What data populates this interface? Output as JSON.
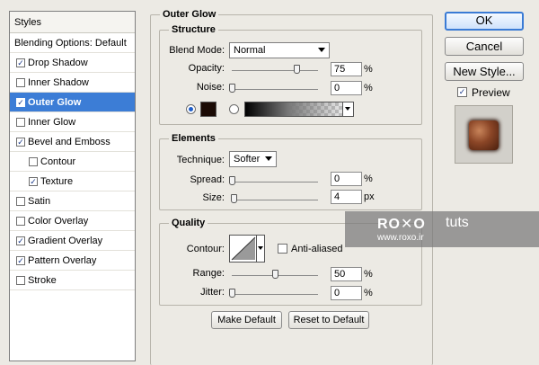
{
  "styles_list": {
    "header": "Styles",
    "blending": "Blending Options: Default",
    "items": [
      {
        "label": "Drop Shadow",
        "checked": true
      },
      {
        "label": "Inner Shadow",
        "checked": false
      },
      {
        "label": "Outer Glow",
        "checked": true
      },
      {
        "label": "Inner Glow",
        "checked": false
      },
      {
        "label": "Bevel and Emboss",
        "checked": true
      },
      {
        "label": "Contour",
        "checked": false
      },
      {
        "label": "Texture",
        "checked": true
      },
      {
        "label": "Satin",
        "checked": false
      },
      {
        "label": "Color Overlay",
        "checked": false
      },
      {
        "label": "Gradient Overlay",
        "checked": true
      },
      {
        "label": "Pattern Overlay",
        "checked": true
      },
      {
        "label": "Stroke",
        "checked": false
      }
    ],
    "check_glyph": "✓"
  },
  "outer_glow": {
    "title": "Outer Glow",
    "structure": {
      "title": "Structure",
      "blend_mode_label": "Blend Mode:",
      "blend_mode_value": "Normal",
      "opacity_label": "Opacity:",
      "opacity_value": "75",
      "opacity_unit": "%",
      "opacity_level": 0.75,
      "noise_label": "Noise:",
      "noise_value": "0",
      "noise_unit": "%",
      "noise_level": 0.0,
      "glow_color": "#1a0a04"
    },
    "elements": {
      "title": "Elements",
      "technique_label": "Technique:",
      "technique_value": "Softer",
      "spread_label": "Spread:",
      "spread_value": "0",
      "spread_unit": "%",
      "spread_level": 0.0,
      "size_label": "Size:",
      "size_value": "4",
      "size_unit": "px",
      "size_level": 0.02
    },
    "quality": {
      "title": "Quality",
      "contour_label": "Contour:",
      "anti_aliased_label": "Anti-aliased",
      "range_label": "Range:",
      "range_value": "50",
      "range_unit": "%",
      "range_level": 0.5,
      "jitter_label": "Jitter:",
      "jitter_value": "0",
      "jitter_unit": "%",
      "jitter_level": 0.0
    },
    "make_default": "Make Default",
    "reset_default": "Reset to Default"
  },
  "dialog_buttons": {
    "ok": "OK",
    "cancel": "Cancel",
    "new_style": "New Style...",
    "preview_label": "Preview"
  },
  "watermark": {
    "logo": "RO✕O",
    "brand": "tuts",
    "site": "www.roxo.ir"
  },
  "colors": {
    "accent": "#3c7dd6",
    "panel_bg": "#eceae4"
  }
}
